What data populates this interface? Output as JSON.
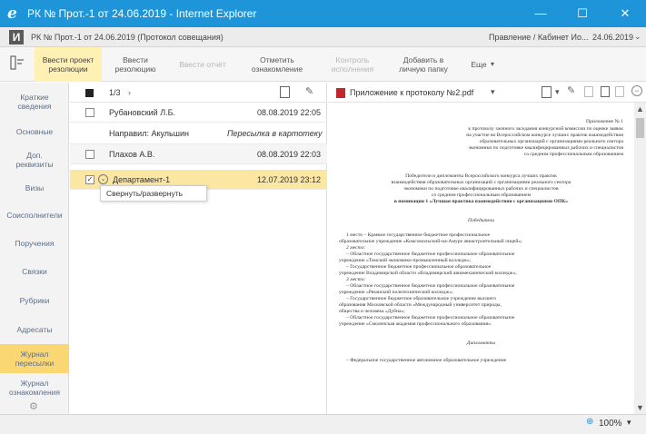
{
  "window": {
    "title": "РК № Прот.-1 от 24.06.2019 - Internet Explorer",
    "controls": [
      "—",
      "☐",
      "✕"
    ]
  },
  "header": {
    "logo": "И",
    "doc_title": "РК № Прот.-1 от 24.06.2019 (Протокол совещания)",
    "department": "Правление / Кабинет Ио...",
    "date": "24.06.2019"
  },
  "toolbar": {
    "b1": "Ввести проект\nрезолюции",
    "b2": "Ввести\nрезолюцию",
    "b3": "Ввести отчёт",
    "b4": "Отметить\nознакомление",
    "b5": "Контроль\nисполнения",
    "b6": "Добавить в\nличную папку",
    "b7": "Еще"
  },
  "sidebar": {
    "items": [
      "Краткие\nсведения",
      "Основные",
      "Доп.\nреквизиты",
      "Визы",
      "Соисполнители",
      "Поручения",
      "Связки",
      "Рубрики",
      "Адресаты",
      "Журнал\nпересылки",
      "Журнал\nознакомления"
    ]
  },
  "list": {
    "pager": "1/3",
    "rows": [
      {
        "name": "Рубановский Л.Б.",
        "date": "08.08.2019 22:05"
      },
      {
        "label": "Направил: Акульшин",
        "status": "Пересылка в картотеку"
      },
      {
        "name": "Плахов А.В.",
        "date": "08.08.2019 22:03"
      },
      {
        "name": "Департамент-1",
        "date": "12.07.2019 23:12"
      }
    ],
    "tooltip": "Свернуть/развернуть"
  },
  "preview": {
    "attachment": "Приложение к протоколу №2.pdf",
    "doc": {
      "appendix": "Приложение № 1",
      "header_lines": [
        "к протоколу заочного заседания конкурсной комиссии по оценке заявок",
        "на участие во Всероссийском конкурсе лучших практик взаимодействия",
        "образовательных организаций с организациями реального сектора",
        "экономики по подготовке квалифицированных рабочих и специалистов",
        "со средним профессиональным образованием"
      ],
      "title_lines": [
        "Победители и дипломанты Всероссийского конкурса лучших практик",
        "взаимодействия образовательных организаций с организациями реального сектора",
        "экономики по подготовке квалифицированных рабочих и специалистов",
        "со средним профессиональным образованием"
      ],
      "nomination": "в номинации 1 «Лучшая практика взаимодействия с организациями ОПК»",
      "winners_heading": "Победители",
      "body_lines": [
        "1 место – Краевое государственное бюджетное профессиональное",
        "образовательное учреждение «Комсомольский-на-Амуре авиастроительный лицей»;",
        "2 место:",
        "– Областное государственное бюджетное профессиональное образовательное",
        "учреждение «Томский экономико-промышленный колледж»;",
        "– Государственное бюджетное профессиональное образовательное",
        "учреждение Владимирской области «Владимирский авиамеханический колледж»;",
        "3 место:",
        "– Областное государственное бюджетное профессиональное образовательное",
        "учреждение «Рязанский политехнический колледж»;",
        "– Государственное бюджетное образовательное учреждение высшего",
        "образования Московской области «Международный университет природы,",
        "общества и человека «Дубна»;",
        "– Областное государственное бюджетное профессиональное образовательное",
        "учреждение «Смоленская академия профессионального образования»."
      ],
      "diplomats_heading": "Дипломанты",
      "last_line": "– Федеральное государственное автономное образовательное учреждение"
    }
  },
  "status": {
    "zoom": "100%"
  },
  "colors": {
    "titlebar": "#1e95d8",
    "active_nav": "#fbd774",
    "active_toolbar": "#fff0b3",
    "selected_row": "#fbe6a2"
  }
}
